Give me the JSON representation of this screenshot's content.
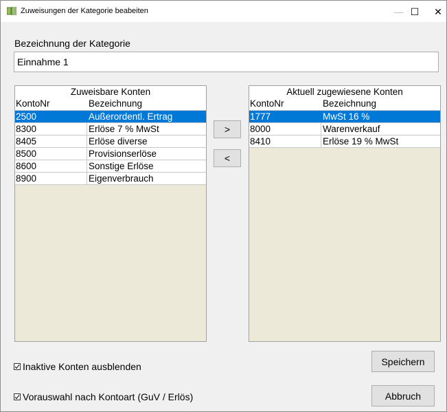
{
  "window": {
    "title": "Zuweisungen der Kategorie beabeiten",
    "controls": {
      "minimize": "—",
      "maximize": "☐",
      "close": "✕"
    },
    "icon": "app-icon"
  },
  "form": {
    "category_label": "Bezeichnung der Kategorie",
    "category_value": "Einnahme 1"
  },
  "left_list": {
    "title": "Zuweisbare Konten",
    "columns": [
      "KontoNr",
      "Bezeichnung"
    ],
    "rows": [
      {
        "nr": "2500",
        "name": "Außerordentl. Ertrag",
        "selected": true
      },
      {
        "nr": "8300",
        "name": "Erlöse 7 % MwSt"
      },
      {
        "nr": "8405",
        "name": "Erlöse diverse"
      },
      {
        "nr": "8500",
        "name": "Provisionserlöse"
      },
      {
        "nr": "8600",
        "name": "Sonstige Erlöse"
      },
      {
        "nr": "8900",
        "name": "Eigenverbrauch"
      }
    ]
  },
  "right_list": {
    "title": "Aktuell zugewiesene Konten",
    "columns": [
      "KontoNr",
      "Bezeichnung"
    ],
    "rows": [
      {
        "nr": "1777",
        "name": "MwSt 16 %",
        "selected": true
      },
      {
        "nr": "8000",
        "name": "Warenverkauf"
      },
      {
        "nr": "8410",
        "name": "Erlöse 19 % MwSt"
      }
    ]
  },
  "move_buttons": {
    "assign": ">",
    "unassign": "<"
  },
  "options": {
    "hide_inactive": {
      "label": "Inaktive Konten ausblenden",
      "checked": true
    },
    "preselect_by_type": {
      "label": "Vorauswahl nach Kontoart (GuV / Erlös)",
      "checked": true
    }
  },
  "actions": {
    "save": "Speichern",
    "cancel": "Abbruch"
  },
  "colors": {
    "selection": "#0078d7",
    "list_background": "#ece9d8",
    "dialog_background": "#f0f0f0"
  }
}
